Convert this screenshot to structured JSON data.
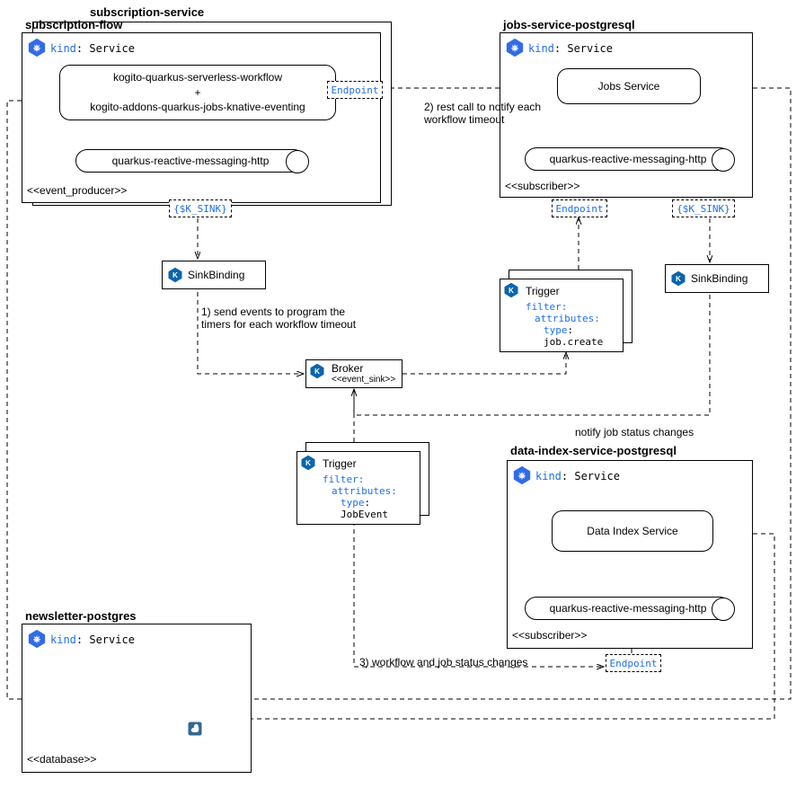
{
  "subscriptionService": {
    "title": "subscription-service"
  },
  "subscriptionFlow": {
    "title": "subscription-flow",
    "kindLabel": "kind",
    "kindValue": "Service",
    "box1": "kogito-quarkus-serverless-workflow\n+\nkogito-addons-quarkus-jobs-knative-eventing",
    "qrmh": "quarkus-reactive-messaging-http",
    "producer": "<<event_producer>>",
    "ksink": "{$K_SINK}"
  },
  "sinkBinding": {
    "label": "SinkBinding"
  },
  "note1": "1) send events to program the\ntimers for each workflow timeout",
  "broker": {
    "label": "Broker",
    "sink": "<<event_sink>>"
  },
  "trigger1": {
    "label": "Trigger",
    "filter": "filter",
    "attributes": "attributes",
    "type": "type",
    "typeVal": "job.create"
  },
  "trigger2": {
    "label": "Trigger",
    "filter": "filter",
    "attributes": "attributes",
    "type": "type",
    "typeVal": "JobEvent"
  },
  "jobsService": {
    "title": "jobs-service-postgresql",
    "kindLabel": "kind",
    "kindValue": "Service",
    "svc": "Jobs Service",
    "qrmh": "quarkus-reactive-messaging-http",
    "subscriber": "<<subscriber>>",
    "endpoint": "Endpoint",
    "ksink": "{$K_SINK}"
  },
  "note2": "2) rest call to notify each\nworkflow timeout",
  "noteStatus": "notify job status changes",
  "dataIndex": {
    "title": "data-index-service-postgresql",
    "kindLabel": "kind",
    "kindValue": "Service",
    "svc": "Data Index Service",
    "qrmh": "quarkus-reactive-messaging-http",
    "subscriber": "<<subscriber>>",
    "endpoint": "Endpoint"
  },
  "note3": "3) workflow and job status changes",
  "newsletter": {
    "title": "newsletter-postgres",
    "kindLabel": "kind",
    "kindValue": "Service",
    "database": "<<database>>"
  },
  "endpointLabel": "Endpoint"
}
